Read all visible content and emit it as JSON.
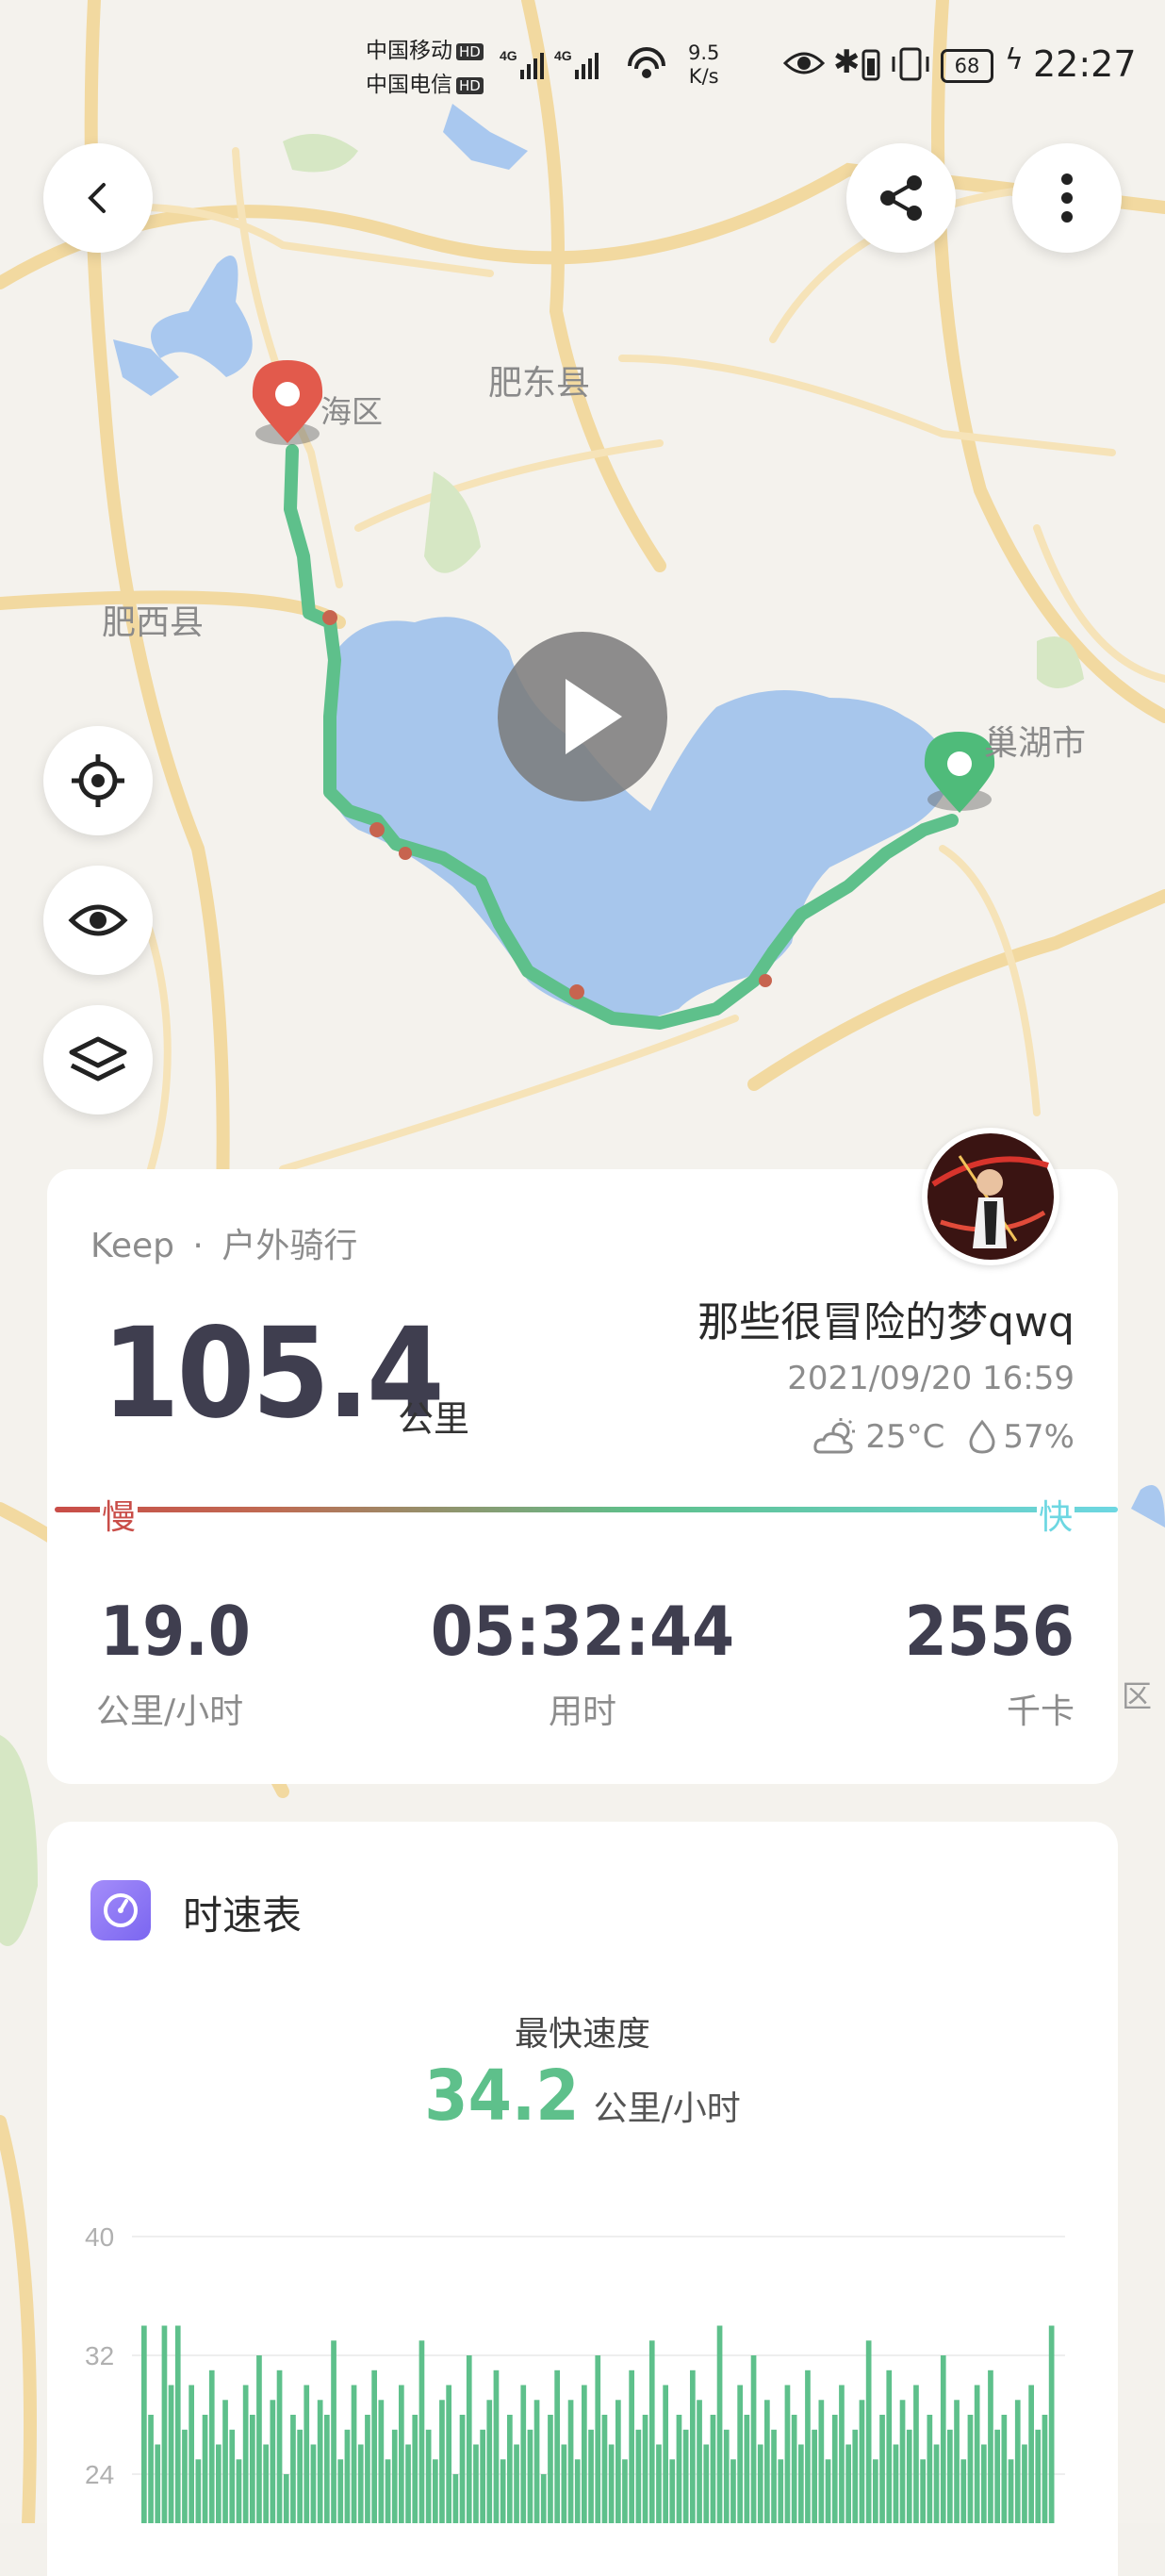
{
  "status_bar": {
    "carrier1": "中国移动",
    "carrier2": "中国电信",
    "hd": "HD",
    "net_speed": "9.5",
    "net_unit": "K/s",
    "battery": "68",
    "time": "22:27"
  },
  "map": {
    "labels": {
      "shushan": "海区",
      "feidong": "肥东县",
      "feixi": "肥西县",
      "chaohu": "巢湖市",
      "edge_district": "区"
    }
  },
  "summary": {
    "source": "Keep",
    "dot": "·",
    "activity": "户外骑行",
    "distance": "105.4",
    "distance_unit": "公里",
    "user": "那些很冒险的梦qwq",
    "datetime": "2021/09/20 16:59",
    "temperature": "25°C",
    "humidity": "57%",
    "slow_label": "慢",
    "fast_label": "快",
    "stats": [
      {
        "value": "19.0",
        "label": "公里/小时"
      },
      {
        "value": "05:32:44",
        "label": "用时"
      },
      {
        "value": "2556",
        "label": "千卡"
      }
    ]
  },
  "speedometer": {
    "title": "时速表",
    "max_label": "最快速度",
    "max_value": "34.2",
    "max_unit": "公里/小时",
    "y_ticks": [
      "40",
      "32",
      "24"
    ]
  },
  "chart_data": {
    "type": "bar",
    "title": "时速表",
    "ylabel": "",
    "ylim": [
      20,
      40
    ],
    "color": "#5ec08b",
    "values": [
      34,
      28,
      26,
      34,
      30,
      34,
      27,
      30,
      25,
      28,
      31,
      26,
      29,
      27,
      25,
      30,
      28,
      32,
      26,
      29,
      31,
      24,
      28,
      27,
      30,
      26,
      29,
      28,
      33,
      25,
      27,
      30,
      26,
      28,
      31,
      29,
      25,
      27,
      30,
      26,
      28,
      33,
      27,
      25,
      29,
      30,
      24,
      28,
      32,
      26,
      27,
      29,
      31,
      25,
      28,
      26,
      30,
      27,
      29,
      24,
      28,
      31,
      26,
      29,
      25,
      30,
      27,
      32,
      28,
      26,
      29,
      25,
      31,
      27,
      28,
      33,
      26,
      30,
      25,
      28,
      27,
      31,
      29,
      26,
      28,
      34,
      27,
      25,
      30,
      28,
      32,
      26,
      29,
      27,
      25,
      30,
      28,
      26,
      31,
      27,
      29,
      25,
      28,
      30,
      26,
      27,
      29,
      33,
      25,
      28,
      31,
      26,
      29,
      27,
      30,
      25,
      28,
      26,
      32,
      27,
      29,
      25,
      28,
      30,
      26,
      31,
      27,
      28,
      25,
      29,
      26,
      30,
      27,
      28,
      34
    ]
  }
}
